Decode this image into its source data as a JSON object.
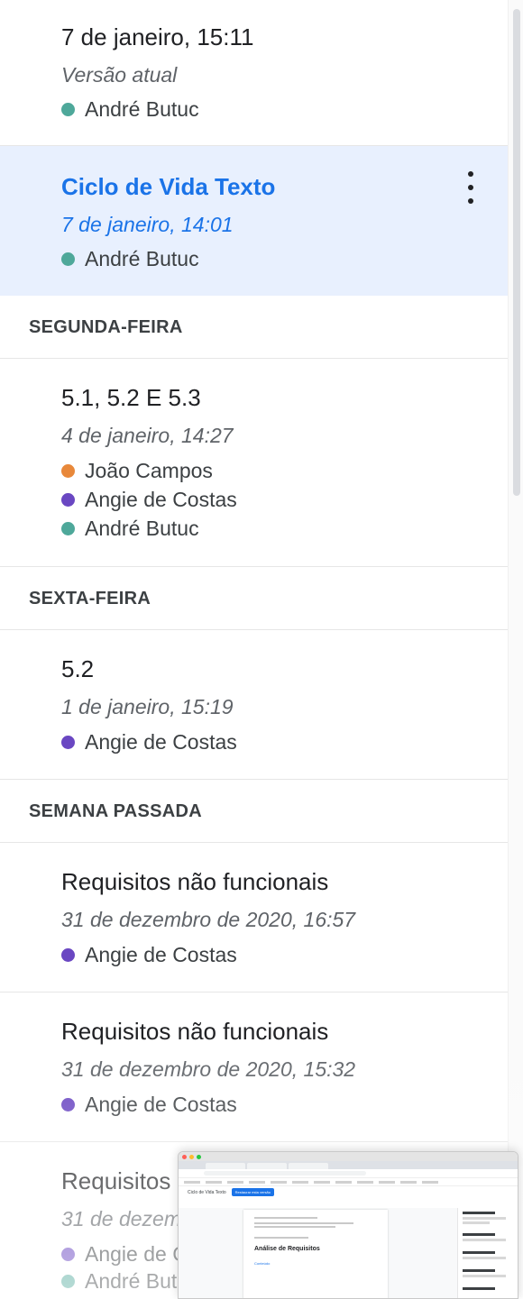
{
  "versions": [
    {
      "title": "7 de janeiro, 15:11",
      "subtitle": "Versão atual",
      "authors": [
        "André Butuc"
      ]
    },
    {
      "title": "Ciclo de Vida Texto",
      "subtitle": "7 de janeiro, 14:01",
      "authors": [
        "André Butuc"
      ],
      "selected": true
    },
    {
      "title": "5.1, 5.2 E 5.3",
      "subtitle": "4 de janeiro, 14:27",
      "authors": [
        "João Campos",
        "Angie de Costas",
        "André Butuc"
      ]
    },
    {
      "title": "5.2",
      "subtitle": "1 de janeiro, 15:19",
      "authors": [
        "Angie de Costas"
      ]
    },
    {
      "title": "Requisitos não funcionais",
      "subtitle": "31 de dezembro de 2020, 16:57",
      "authors": [
        "Angie de Costas"
      ]
    },
    {
      "title": "Requisitos não funcionais",
      "subtitle": "31 de dezembro de 2020, 15:32",
      "authors": [
        "Angie de Costas"
      ]
    },
    {
      "title": "Requisitos não funcionais",
      "subtitle": "31 de dezembro de 2020",
      "authors": [
        "Angie de Costas",
        "André Butuc"
      ]
    }
  ],
  "sections": {
    "monday": "SEGUNDA-FEIRA",
    "friday": "SEXTA-FEIRA",
    "last_week": "SEMANA PASSADA"
  },
  "colors": {
    "andre": "#4ea89a",
    "joao": "#e8883a",
    "angie": "#6a47c2",
    "selected_bg": "#e8f0fe",
    "accent": "#1a73e8"
  },
  "thumbnail": {
    "doc_title": "Ciclo de Vida Texto",
    "restore_label": "Restaurar esta versão",
    "heading": "Análise de Requisitos",
    "toc_label": "Conteúdo",
    "history_label": "Histórico de versões"
  }
}
